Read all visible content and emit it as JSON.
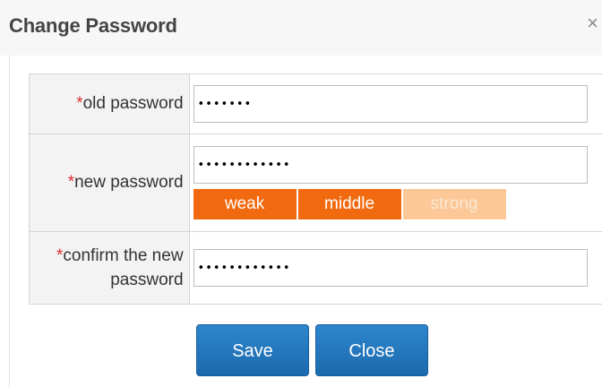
{
  "dialog": {
    "title": "Change Password",
    "close_glyph": "×"
  },
  "form": {
    "required_marker": "*",
    "old_password": {
      "label": "old password",
      "value": "•••••••"
    },
    "new_password": {
      "label": "new password",
      "value": "••••••••••••",
      "strength": {
        "levels": [
          "weak",
          "middle",
          "strong"
        ],
        "active_count": 2
      }
    },
    "confirm_password": {
      "label_line1": "confirm the new",
      "label_line2": "password",
      "value": "••••••••••••"
    }
  },
  "buttons": {
    "save_label": "Save",
    "close_label": "Close"
  },
  "colors": {
    "accent_blue": "#1b69ad",
    "strength_active": "#f26a10",
    "strength_inactive": "#fcc898",
    "required": "#d9302f"
  }
}
